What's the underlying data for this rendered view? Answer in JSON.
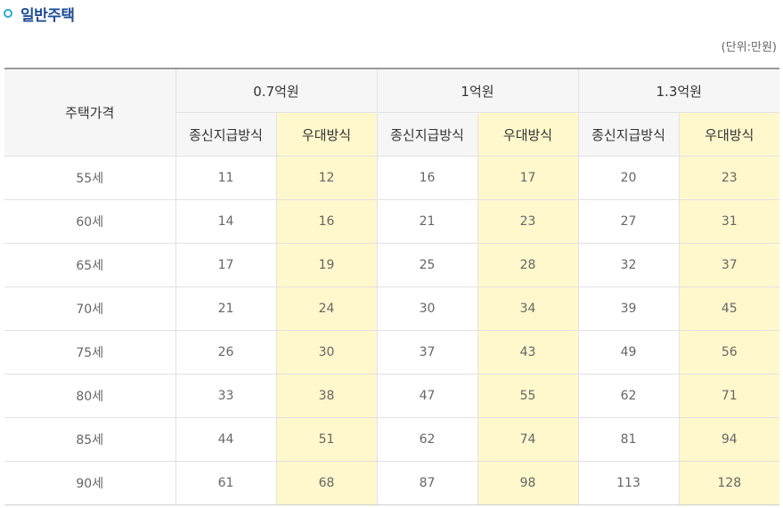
{
  "section": {
    "title": "일반주택",
    "unit": "(단위:만원)"
  },
  "table": {
    "row_header": "주택가격",
    "price_groups": [
      "0.7억원",
      "1억원",
      "1.3억원"
    ],
    "method_labels": [
      "종신지급방식",
      "우대방식",
      "종신지급방식",
      "우대방식",
      "종신지급방식",
      "우대방식"
    ],
    "rows": [
      {
        "age": "55세",
        "values": [
          "11",
          "12",
          "16",
          "17",
          "20",
          "23"
        ]
      },
      {
        "age": "60세",
        "values": [
          "14",
          "16",
          "21",
          "23",
          "27",
          "31"
        ]
      },
      {
        "age": "65세",
        "values": [
          "17",
          "19",
          "25",
          "28",
          "32",
          "37"
        ]
      },
      {
        "age": "70세",
        "values": [
          "21",
          "24",
          "30",
          "34",
          "39",
          "45"
        ]
      },
      {
        "age": "75세",
        "values": [
          "26",
          "30",
          "37",
          "43",
          "49",
          "56"
        ]
      },
      {
        "age": "80세",
        "values": [
          "33",
          "38",
          "47",
          "55",
          "62",
          "71"
        ]
      },
      {
        "age": "85세",
        "values": [
          "44",
          "51",
          "62",
          "74",
          "81",
          "94"
        ]
      },
      {
        "age": "90세",
        "values": [
          "61",
          "68",
          "87",
          "98",
          "113",
          "128"
        ]
      }
    ]
  },
  "colors": {
    "title": "#1f4e96",
    "bullet": "#2aa7d7",
    "highlight": "#fff8cc",
    "header_bg": "#f6f6f6"
  }
}
